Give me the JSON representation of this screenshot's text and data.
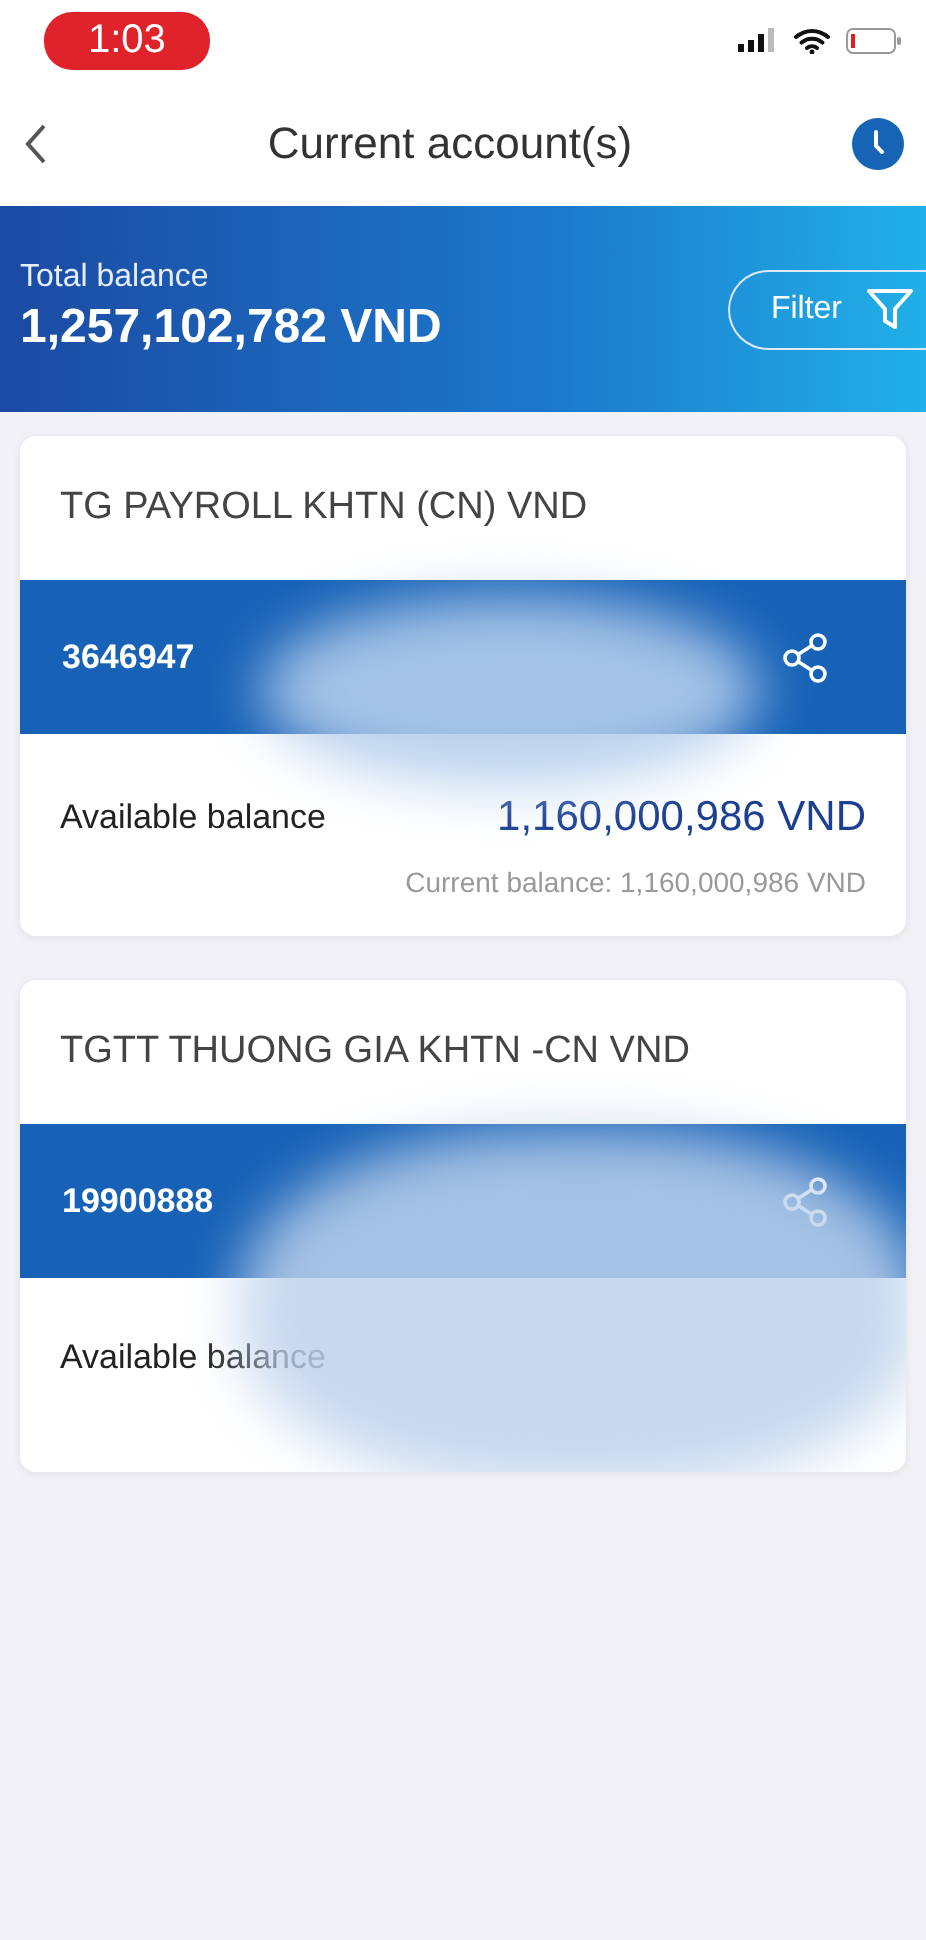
{
  "status_bar": {
    "time": "1:03"
  },
  "header": {
    "title": "Current account(s)"
  },
  "summary": {
    "label": "Total balance",
    "amount": "1,257,102,782 VND",
    "filter_label": "Filter"
  },
  "accounts": [
    {
      "name": "TG PAYROLL KHTN (CN) VND",
      "number": "3646947",
      "redacted": true,
      "available_label": "Available balance",
      "available": "1,160,000,986 VND",
      "current": "Current balance: 1,160,000,986 VND"
    },
    {
      "name": "TGTT THUONG GIA KHTN -CN VND",
      "number": "19900888",
      "redacted": true,
      "available_label": "Available balance"
    }
  ]
}
